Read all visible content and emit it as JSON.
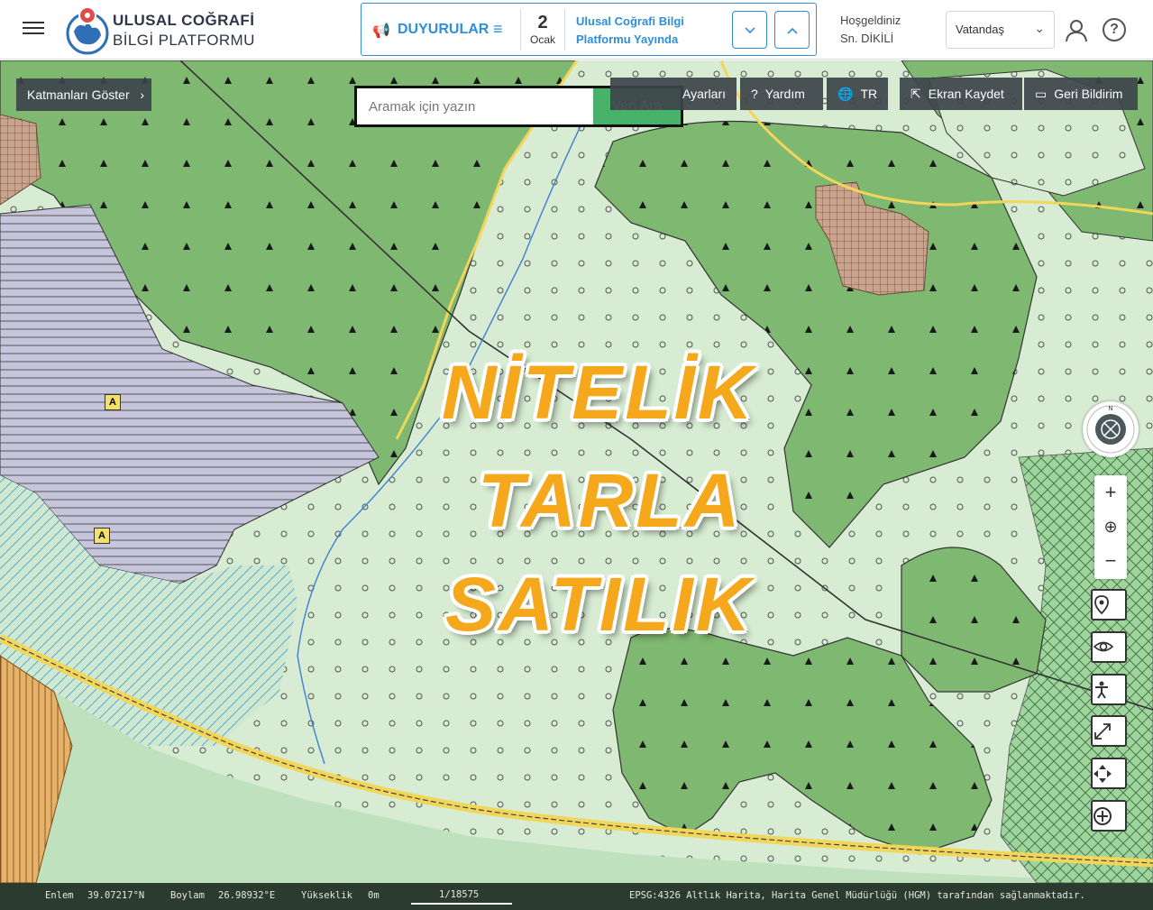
{
  "header": {
    "brand_line1": "ULUSAL COĞRAFİ",
    "brand_line2": "BİLGİ PLATFORMU",
    "announcements": {
      "title": "DUYURULAR",
      "day": "2",
      "month": "Ocak",
      "text": "Ulusal Coğrafi Bilgi Platformu Yayında"
    },
    "welcome_line1": "Hoşgeldiniz",
    "welcome_line2": "Sn. DİKİLİ",
    "role": "Vatandaş",
    "icons": [
      "menu-icon",
      "megaphone-icon",
      "list-icon",
      "chevron-down-icon",
      "chevron-up-icon",
      "user-icon",
      "help-icon"
    ]
  },
  "toolbar": {
    "layers_label": "Katmanları Göster",
    "search_placeholder": "Aramak için yazın",
    "search_button": "Veri Ara",
    "settings_label": "Ayarları",
    "help_label": "Yardım",
    "lang_label": "TR",
    "save_label": "Ekran Kaydet",
    "feedback_label": "Geri Bildirim"
  },
  "overlay": {
    "line1": "NİTELİK",
    "line2": "TARLA",
    "line3": "SATILIK"
  },
  "map_labels": {
    "marker_a": "A"
  },
  "status": {
    "lat_label": "Enlem",
    "lat_value": "39.07217°N",
    "lon_label": "Boylam",
    "lon_value": "26.98932°E",
    "alt_label": "Yükseklik",
    "alt_value": "0m",
    "scale": "1/18575",
    "attribution": "EPSG:4326 Altlık Harita, Harita Genel Müdürlüğü (HGM) tarafından sağlanmaktadır."
  },
  "colors": {
    "accent": "#2f8fd8",
    "search_green": "#49b26a",
    "forest": "#7fb870",
    "field": "#d7ecd3",
    "settlement": "#caa38c",
    "water_blue": "#3d7fd6",
    "road_yellow": "#f2d65a",
    "overlay_orange": "#f6a81c"
  }
}
